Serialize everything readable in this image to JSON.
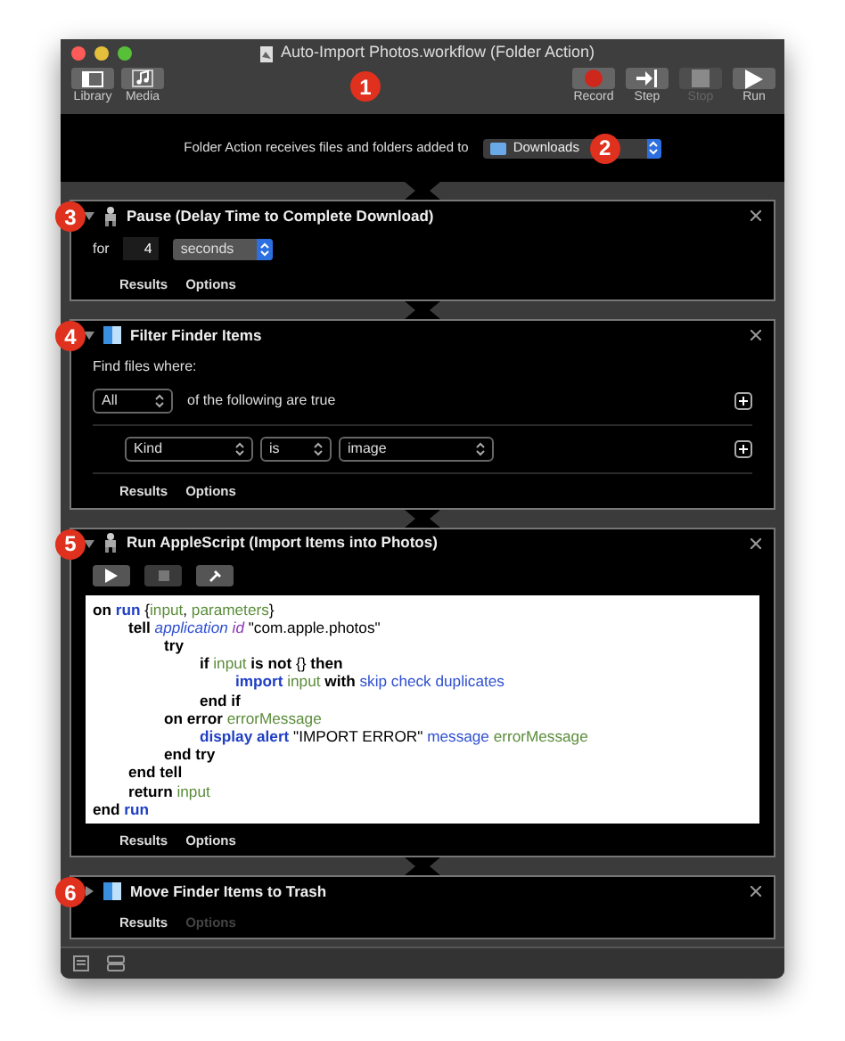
{
  "window": {
    "title": "Auto-Import Photos.workflow (Folder Action)"
  },
  "toolbar": {
    "left": [
      {
        "label": "Library",
        "kind": "library"
      },
      {
        "label": "Media",
        "kind": "media"
      }
    ],
    "badge": "1",
    "right": [
      {
        "label": "Record",
        "kind": "record",
        "disabled": false
      },
      {
        "label": "Step",
        "kind": "step",
        "disabled": false
      },
      {
        "label": "Stop",
        "kind": "stop",
        "disabled": true
      },
      {
        "label": "Run",
        "kind": "run",
        "disabled": false
      }
    ]
  },
  "receiver": {
    "label": "Folder Action receives files and folders added to",
    "folder": "Downloads",
    "badge": "2"
  },
  "actions": [
    {
      "kind": "pause",
      "badge": "3",
      "title": "Pause (Delay Time to Complete Download)",
      "expanded": true,
      "for_label": "for",
      "amount": "4",
      "unit": "seconds",
      "tabs": [
        {
          "label": "Results",
          "disabled": false
        },
        {
          "label": "Options",
          "disabled": false
        }
      ]
    },
    {
      "kind": "filter",
      "badge": "4",
      "title": "Filter Finder Items",
      "expanded": true,
      "heading": "Find files where:",
      "match": "All",
      "match_label": "of the following are true",
      "conditions": [
        {
          "field": "Kind",
          "operator": "is",
          "value": "image"
        }
      ],
      "tabs": [
        {
          "label": "Results",
          "disabled": false
        },
        {
          "label": "Options",
          "disabled": false
        }
      ]
    },
    {
      "kind": "script",
      "badge": "5",
      "title": "Run AppleScript (Import Items into Photos)",
      "expanded": true,
      "code": [
        {
          "tokens": [
            {
              "text": "on",
              "kind": "keyword"
            },
            {
              "text": " run",
              "kind": "command"
            },
            {
              "text": " {",
              "kind": "plain"
            },
            {
              "text": "input",
              "kind": "variable"
            },
            {
              "text": ", ",
              "kind": "plain"
            },
            {
              "text": "parameters",
              "kind": "variable"
            },
            {
              "text": "}",
              "kind": "plain"
            }
          ],
          "children": [
            {
              "tokens": [
                {
                  "text": "tell",
                  "kind": "keyword"
                },
                {
                  "text": " application",
                  "kind": "class"
                },
                {
                  "text": " id",
                  "kind": "id"
                },
                {
                  "text": " \"com.apple.photos\"",
                  "kind": "plain"
                }
              ],
              "children": [
                {
                  "tokens": [
                    {
                      "text": "try",
                      "kind": "keyword"
                    }
                  ],
                  "children": [
                    {
                      "tokens": [
                        {
                          "text": "if",
                          "kind": "keyword"
                        },
                        {
                          "text": " input",
                          "kind": "variable"
                        },
                        {
                          "text": " is not",
                          "kind": "keyword"
                        },
                        {
                          "text": " {} ",
                          "kind": "plain"
                        },
                        {
                          "text": "then",
                          "kind": "keyword"
                        }
                      ],
                      "children": [
                        {
                          "tokens": [
                            {
                              "text": "import",
                              "kind": "command"
                            },
                            {
                              "text": " input",
                              "kind": "variable"
                            },
                            {
                              "text": " with",
                              "kind": "keyword"
                            },
                            {
                              "text": " skip check duplicates",
                              "kind": "property"
                            }
                          ]
                        }
                      ]
                    },
                    {
                      "tokens": [
                        {
                          "text": "end if",
                          "kind": "keyword"
                        }
                      ]
                    }
                  ]
                },
                {
                  "tokens": [
                    {
                      "text": "on error",
                      "kind": "keyword"
                    },
                    {
                      "text": " errorMessage",
                      "kind": "variable"
                    }
                  ],
                  "children": [
                    {
                      "tokens": [
                        {
                          "text": "display alert",
                          "kind": "command"
                        },
                        {
                          "text": " \"IMPORT ERROR\" ",
                          "kind": "plain"
                        },
                        {
                          "text": "message",
                          "kind": "property"
                        },
                        {
                          "text": " errorMessage",
                          "kind": "variable"
                        }
                      ]
                    }
                  ]
                },
                {
                  "tokens": [
                    {
                      "text": "end try",
                      "kind": "keyword"
                    }
                  ]
                }
              ]
            },
            {
              "tokens": [
                {
                  "text": "end tell",
                  "kind": "keyword"
                }
              ]
            },
            {
              "tokens": [
                {
                  "text": "return",
                  "kind": "keyword"
                },
                {
                  "text": " input",
                  "kind": "variable"
                }
              ]
            }
          ]
        },
        {
          "tokens": [
            {
              "text": "end",
              "kind": "keyword"
            },
            {
              "text": " run",
              "kind": "command"
            }
          ]
        }
      ],
      "tabs": [
        {
          "label": "Results",
          "disabled": false
        },
        {
          "label": "Options",
          "disabled": false
        }
      ]
    },
    {
      "kind": "move",
      "badge": "6",
      "title": "Move Finder Items to Trash",
      "expanded": false,
      "tabs": [
        {
          "label": "Results",
          "disabled": false
        },
        {
          "label": "Options",
          "disabled": true
        }
      ]
    }
  ]
}
